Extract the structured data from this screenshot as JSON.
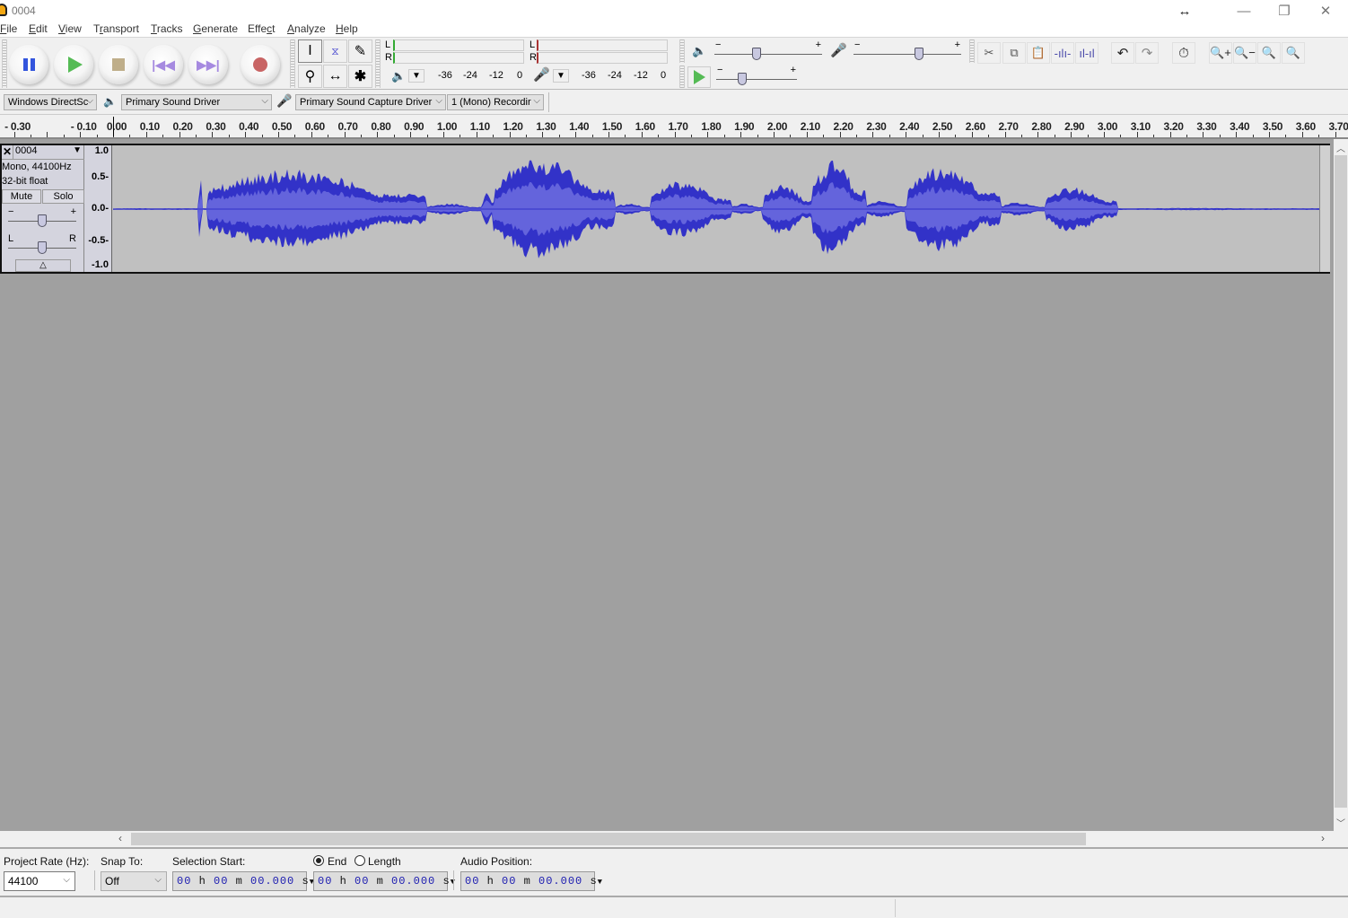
{
  "window": {
    "title": "0004",
    "controls": {
      "resize": "↔",
      "minimize": "—",
      "maximize": "❐",
      "close": "✕"
    }
  },
  "menu": [
    "File",
    "Edit",
    "View",
    "Transport",
    "Tracks",
    "Generate",
    "Effect",
    "Analyze",
    "Help"
  ],
  "transport": {
    "buttons": [
      "pause",
      "play",
      "stop",
      "skip-to-start",
      "skip-to-end",
      "record"
    ]
  },
  "tools": [
    "selection-tool",
    "envelope-tool",
    "draw-tool",
    "zoom-tool",
    "time-shift-tool",
    "multi-tool"
  ],
  "meters": {
    "playback": {
      "channels": [
        "L",
        "R"
      ],
      "scale": [
        "-36",
        "-24",
        "-12",
        "0"
      ]
    },
    "record": {
      "channels": [
        "L",
        "R"
      ],
      "scale": [
        "-36",
        "-24",
        "-12",
        "0"
      ]
    }
  },
  "mixer": {
    "playback_volume": 0.38,
    "record_volume": 0.62,
    "play_at_speed": 0.3,
    "minus": "−",
    "plus": "+"
  },
  "edit_tools": [
    "cut-icon",
    "copy-icon",
    "paste-icon",
    "trim-icon",
    "silence-icon",
    "undo-icon",
    "redo-icon",
    "sync-lock-icon",
    "zoom-in-icon",
    "zoom-out-icon",
    "fit-selection-icon",
    "fit-project-icon"
  ],
  "devices": {
    "host": "Windows DirectSound",
    "host_display": "Windows DirectSc",
    "playback": "Primary Sound Driver",
    "recording": "Primary Sound Capture Driver",
    "channels": "1 (Mono) Recordir"
  },
  "ruler": {
    "labels": [
      "-0.30",
      "-0.10",
      "0.00",
      "0.10",
      "0.20",
      "0.30",
      "0.40",
      "0.50",
      "0.60",
      "0.70",
      "0.80",
      "0.90",
      "1.00",
      "1.10",
      "1.20",
      "1.30",
      "1.40",
      "1.50",
      "1.60",
      "1.70",
      "1.80",
      "1.90",
      "2.00",
      "2.10",
      "2.20",
      "2.30",
      "2.40",
      "2.50",
      "2.60",
      "2.70",
      "2.80",
      "2.90",
      "3.00",
      "3.10",
      "3.20",
      "3.30",
      "3.40",
      "3.50",
      "3.60",
      "3.70"
    ]
  },
  "track": {
    "name": "0004",
    "info1": "Mono, 44100Hz",
    "info2": "32-bit float",
    "mute": "Mute",
    "solo": "Solo",
    "gain_minus": "−",
    "gain_plus": "+",
    "pan_left": "L",
    "pan_right": "R",
    "gain": 0.5,
    "pan": 0.5,
    "vruler": [
      "1.0",
      "0.5-",
      "0.0-",
      "-0.5-",
      "-1.0"
    ],
    "wave_color": "#3232c8",
    "rms_color": "#6464dc"
  },
  "selection_toolbar": {
    "project_rate_label": "Project Rate (Hz):",
    "project_rate": "44100",
    "snap_label": "Snap To:",
    "snap_value": "Off",
    "selection_start_label": "Selection Start:",
    "end_label": "End",
    "length_label": "Length",
    "end_selected": true,
    "audio_position_label": "Audio Position:",
    "selection_start": {
      "h": "00",
      "m": "00",
      "s": "00.000"
    },
    "selection_end": {
      "h": "00",
      "m": "00",
      "s": "00.000"
    },
    "audio_position": {
      "h": "00",
      "m": "00",
      "s": "00.000"
    }
  }
}
